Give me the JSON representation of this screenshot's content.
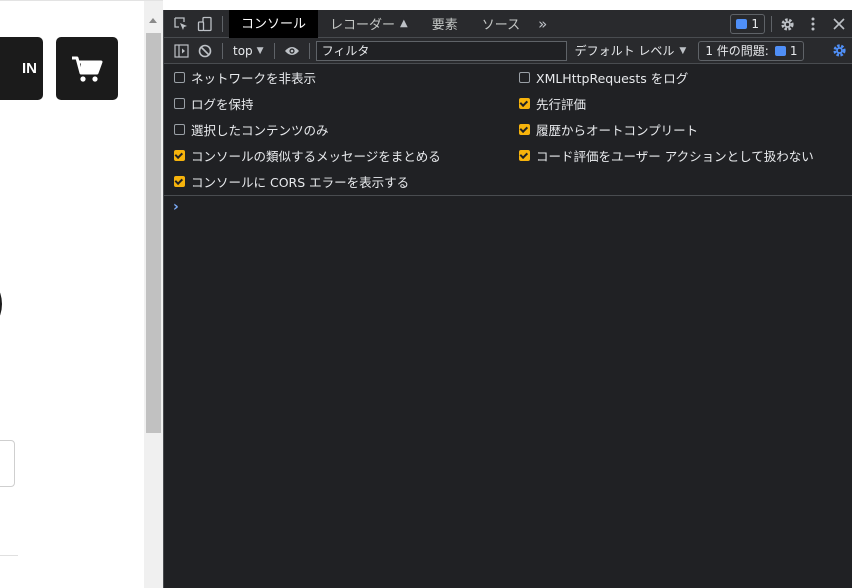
{
  "page": {
    "login_label": "IN"
  },
  "devtools": {
    "tabs": [
      {
        "label": "コンソール",
        "active": true
      },
      {
        "label": "レコーダー",
        "active": false
      },
      {
        "label": "要素",
        "active": false
      },
      {
        "label": "ソース",
        "active": false
      }
    ],
    "more_tabs": "»",
    "message_count": "1",
    "toolbar": {
      "context": "top",
      "filter_placeholder": "フィルタ",
      "levels": "デフォルト レベル",
      "issues_label": "1 件の問題:",
      "issues_count": "1"
    },
    "settings_left": [
      {
        "label": "ネットワークを非表示",
        "checked": false
      },
      {
        "label": "ログを保持",
        "checked": false
      },
      {
        "label": "選択したコンテンツのみ",
        "checked": false
      },
      {
        "label": "コンソールの類似するメッセージをまとめる",
        "checked": true
      },
      {
        "label": "コンソールに CORS エラーを表示する",
        "checked": true
      }
    ],
    "settings_right": [
      {
        "label": "XMLHttpRequests をログ",
        "checked": false
      },
      {
        "label": "先行評価",
        "checked": true
      },
      {
        "label": "履歴からオートコンプリート",
        "checked": true
      },
      {
        "label": "コード評価をユーザー アクションとして扱わない",
        "checked": true
      }
    ],
    "prompt_symbol": "›",
    "colors": {
      "background": "#202124",
      "toolbar": "#292a2d",
      "accent_blue": "#4f8ff7",
      "checkbox_checked": "#f6b30c"
    }
  }
}
